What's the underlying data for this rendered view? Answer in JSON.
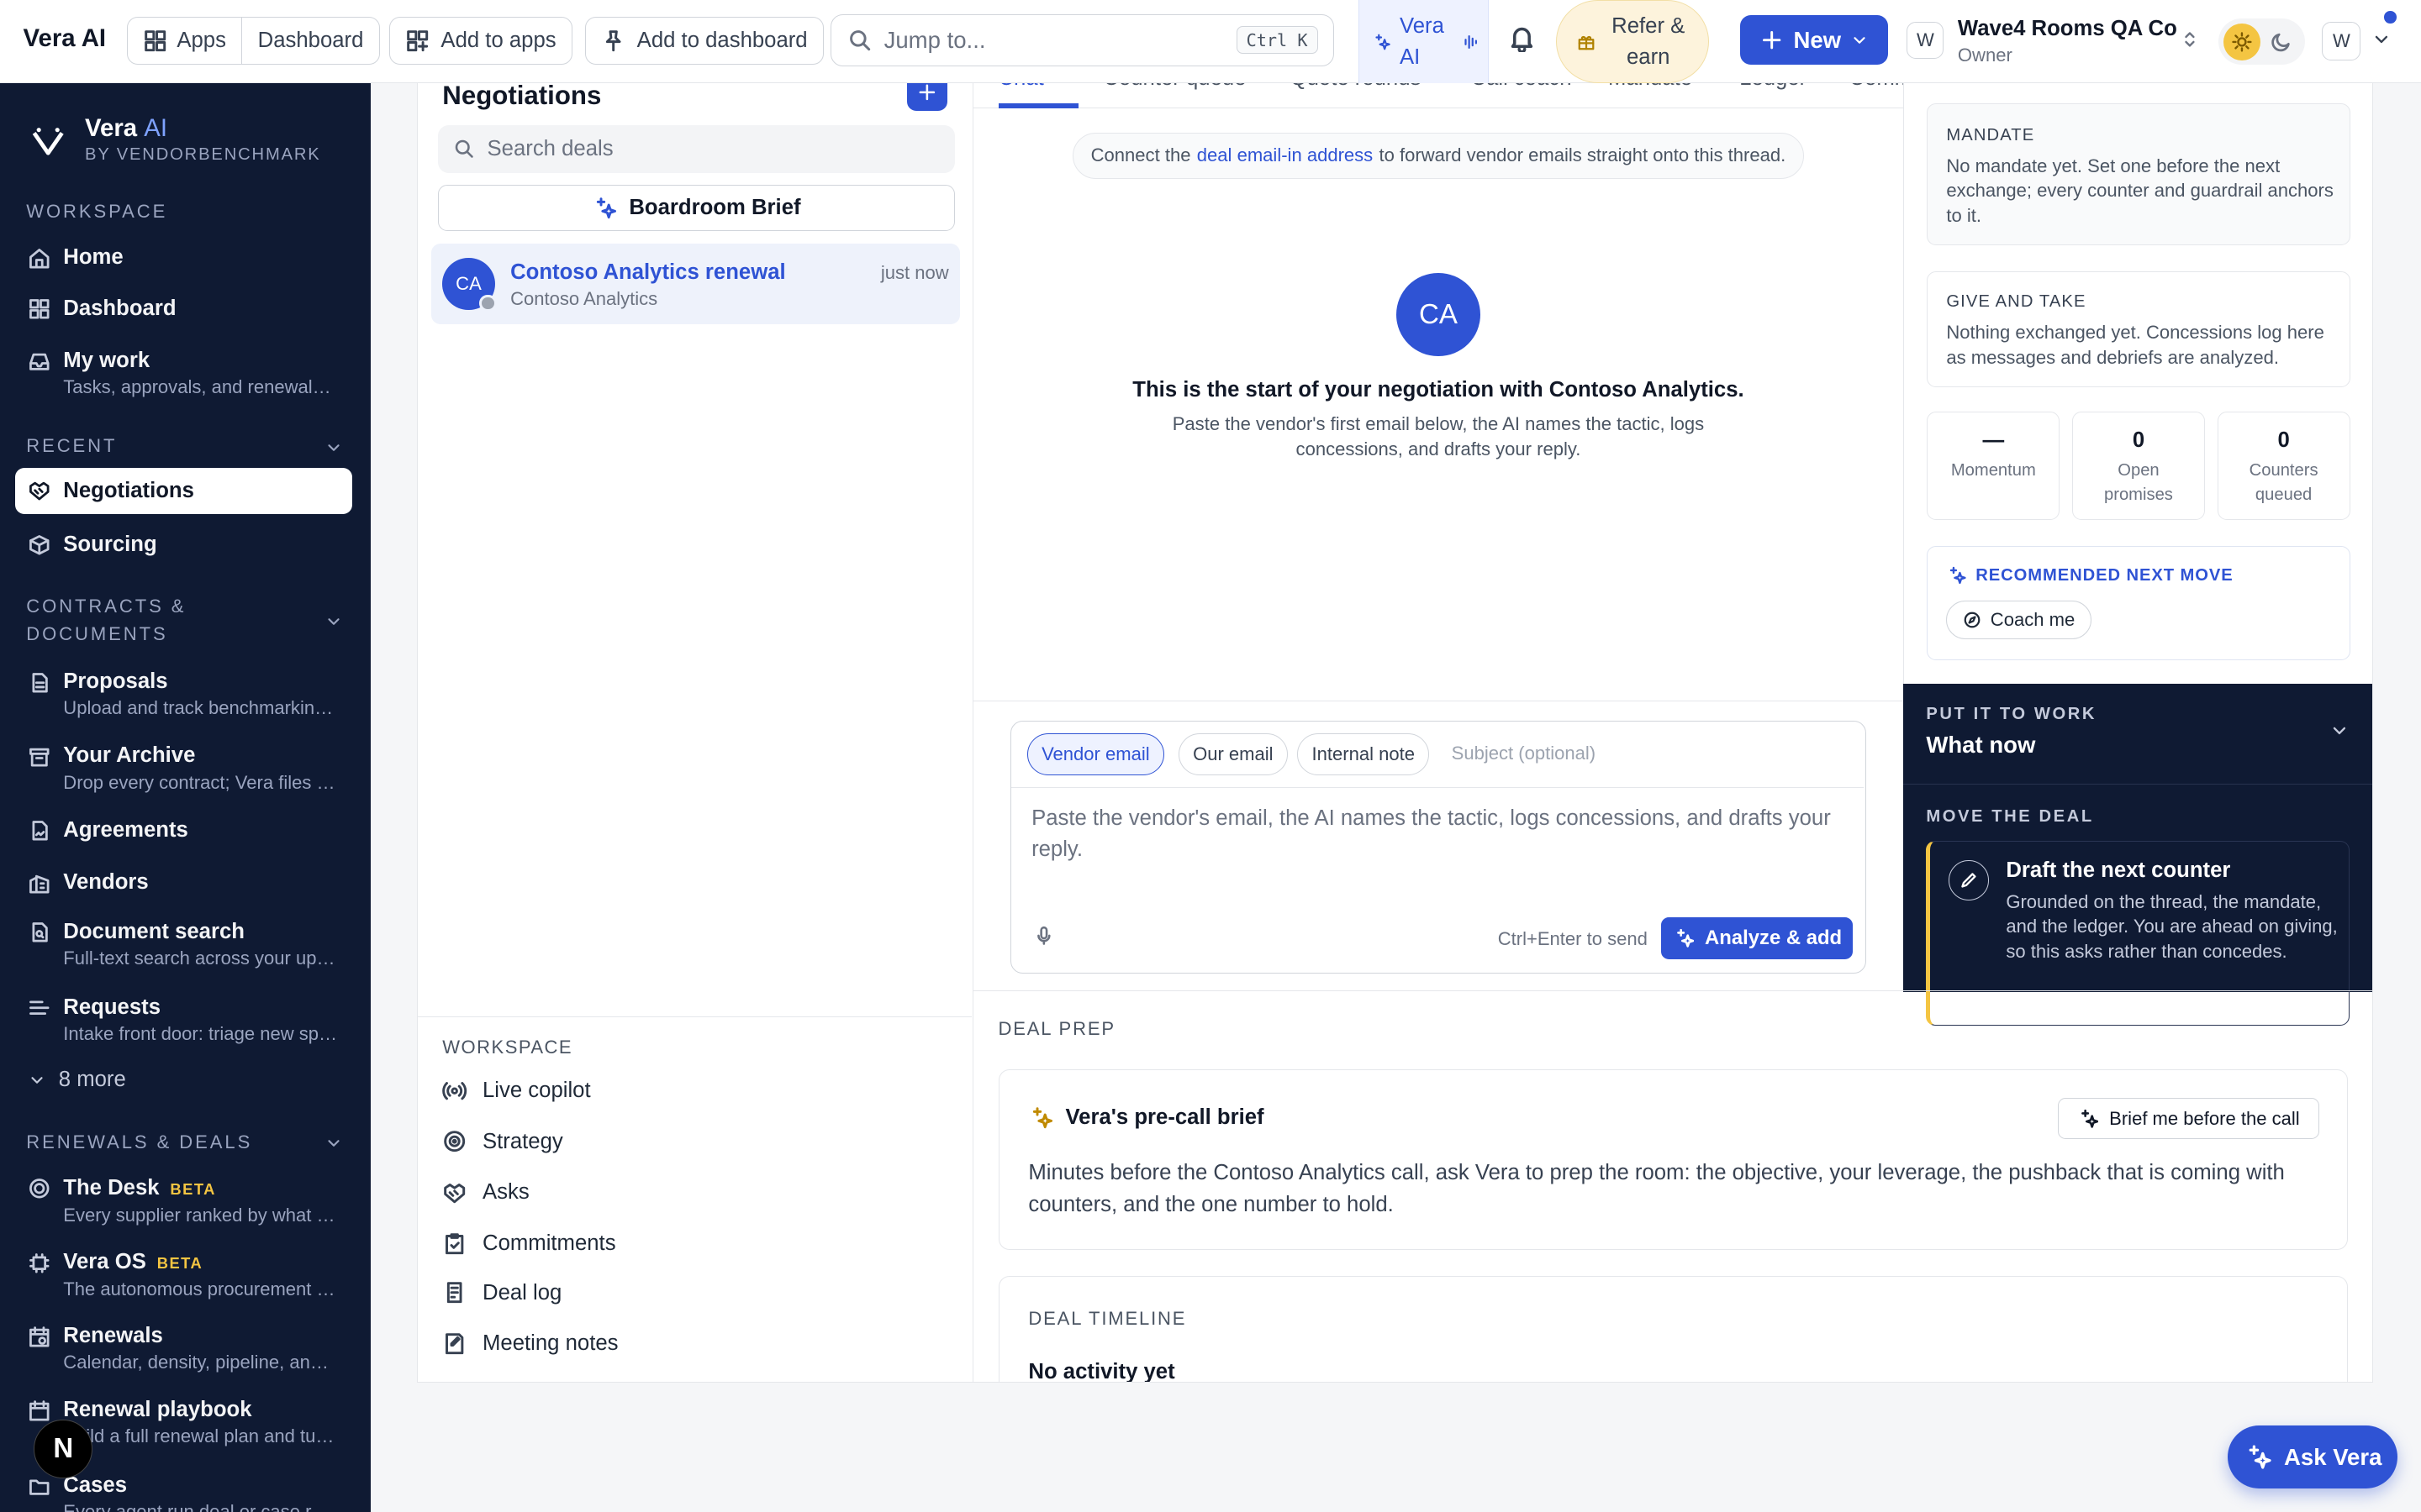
{
  "topbar": {
    "brand": "Vera AI",
    "apps": "Apps",
    "dashboard": "Dashboard",
    "add_to_apps": "Add to apps",
    "add_to_dashboard": "Add to dashboard",
    "search_placeholder": "Jump to...",
    "search_shortcut": "Ctrl K",
    "vera_ai": "Vera AI",
    "refer": "Refer & earn",
    "new": "New",
    "workspace_initial": "W",
    "workspace_name": "Wave4 Rooms QA Co",
    "workspace_role": "Owner",
    "user_initial": "W",
    "accent": "#2f53d4"
  },
  "sidebar": {
    "brand": "Vera",
    "brand_ai": "AI",
    "by": "BY VENDORBENCHMARK",
    "sections": {
      "workspace": "WORKSPACE",
      "recent": "RECENT",
      "contracts_1": "CONTRACTS &",
      "contracts_2": "DOCUMENTS",
      "renewals": "RENEWALS & DEALS"
    },
    "items": {
      "home": "Home",
      "dashboard": "Dashboard",
      "mywork": "My work",
      "mywork_sub": "Tasks, approvals, and renewals needing attention",
      "negotiations": "Negotiations",
      "sourcing": "Sourcing",
      "proposals": "Proposals",
      "proposals_sub": "Upload and track benchmarking requests",
      "archive": "Your Archive",
      "archive_sub": "Drop every contract; Vera files them",
      "agreements": "Agreements",
      "vendors": "Vendors",
      "docsearch": "Document search",
      "docsearch_sub": "Full-text search across your uploads",
      "requests": "Requests",
      "requests_sub": "Intake front door: triage new spend",
      "more": "8 more",
      "desk": "The Desk",
      "desk_badge": "BETA",
      "desk_sub": "Every supplier ranked by what it costs",
      "veraos": "Vera OS",
      "veraos_badge": "BETA",
      "veraos_sub": "The autonomous procurement engine",
      "renewals": "Renewals",
      "renewals_sub": "Calendar, density, pipeline, and more",
      "playbook": "Renewal playbook",
      "playbook_sub": "Build a full renewal plan and tune it",
      "cases": "Cases",
      "cases_sub": "Every agent run deal or case record"
    }
  },
  "list": {
    "title": "Negotiations",
    "search_placeholder": "Search deals",
    "boardroom": "Boardroom Brief",
    "deal": {
      "initials": "CA",
      "name": "Contoso Analytics renewal",
      "company": "Contoso Analytics",
      "time": "just now"
    },
    "workspace_heading": "WORKSPACE",
    "workspace_items": {
      "copilot": "Live copilot",
      "strategy": "Strategy",
      "asks": "Asks",
      "commitments": "Commitments",
      "deallog": "Deal log",
      "notes": "Meeting notes"
    }
  },
  "chat": {
    "tabs": {
      "chat": "Chat",
      "counter": "Counter queue",
      "quote": "Quote rounds",
      "coach": "Call coach",
      "mandate": "Mandate",
      "ledger": "Ledger",
      "comm": "Commitments"
    },
    "connect_pre": "Connect the",
    "connect_link": "deal email-in address",
    "connect_post": "to forward vendor emails straight onto this thread.",
    "avatar": "CA",
    "start_title": "This is the start of your negotiation with Contoso Analytics.",
    "start_sub": "Paste the vendor's first email below, the AI names the tactic, logs concessions, and drafts your reply.",
    "chips": {
      "vendor": "Vendor email",
      "ours": "Our email",
      "internal": "Internal note"
    },
    "subject_placeholder": "Subject (optional)",
    "message_placeholder": "Paste the vendor's email, the AI names the tactic, logs concessions, and drafts your reply.",
    "hint": "Ctrl+Enter to send",
    "analyze": "Analyze & add"
  },
  "right": {
    "mandate_cap": "MANDATE",
    "mandate_txt": "No mandate yet. Set one before the next exchange; every counter and guardrail anchors to it.",
    "give_cap": "GIVE AND TAKE",
    "give_txt": "Nothing exchanged yet. Concessions log here as messages and debriefs are analyzed.",
    "stats": [
      {
        "value": "—",
        "label": "Momentum"
      },
      {
        "value": "0",
        "label": "Open promises"
      },
      {
        "value": "0",
        "label": "Counters queued"
      }
    ],
    "rec_cap": "RECOMMENDED NEXT MOVE",
    "coach": "Coach me",
    "work_cap": "PUT IT TO WORK",
    "work_title": "What now",
    "move_cap": "MOVE THE DEAL",
    "draft_title": "Draft the next counter",
    "draft_sub": "Grounded on the thread, the mandate, and the ledger. You are ahead on giving, so this asks rather than concedes."
  },
  "prep": {
    "caption": "DEAL PREP",
    "brief_title": "Vera's pre-call brief",
    "brief_btn": "Brief me before the call",
    "brief_text": "Minutes before the Contoso Analytics call, ask Vera to prep the room: the objective, your leverage, the pushback that is coming with counters, and the one number to hold.",
    "timeline_cap": "DEAL TIMELINE",
    "timeline_empty": "No activity yet"
  },
  "fab": {
    "ask": "Ask Vera",
    "n": "N"
  }
}
